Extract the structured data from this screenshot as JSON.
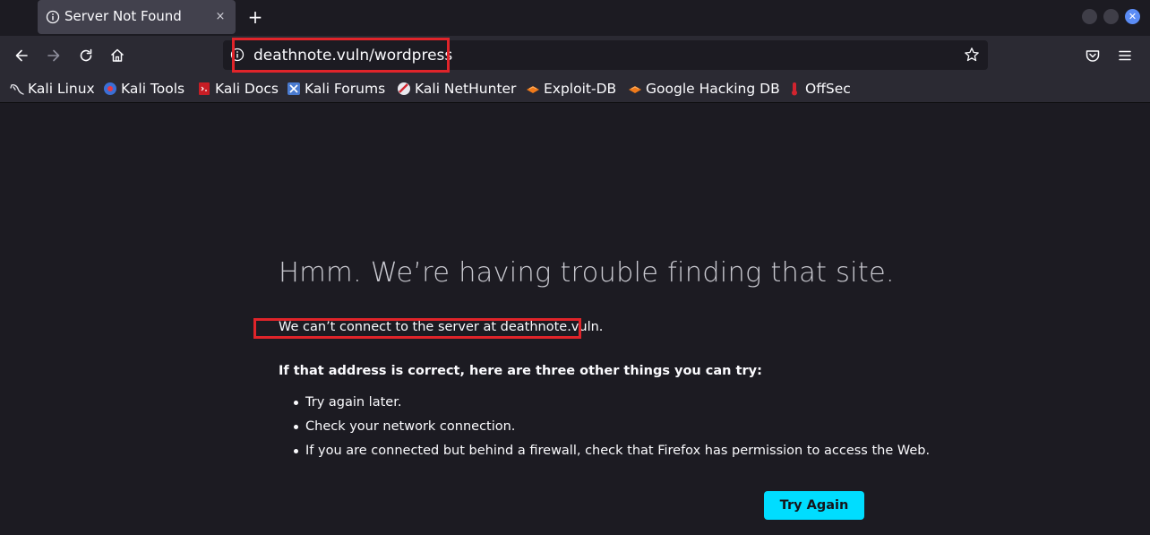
{
  "tab": {
    "title": "Server Not Found",
    "close_glyph": "×",
    "new_tab_glyph": "+"
  },
  "window_controls": [
    "minimize",
    "maximize",
    "close"
  ],
  "nav": {
    "back": "back-arrow-icon",
    "forward": "forward-arrow-icon",
    "reload": "reload-icon",
    "home": "home-icon",
    "url": "deathnote.vuln/wordpress",
    "pocket": "pocket-icon",
    "menu": "hamburger-menu-icon"
  },
  "bookmarks": [
    {
      "label": "Kali Linux",
      "icon": "kali-dragon-icon"
    },
    {
      "label": "Kali Tools",
      "icon": "kali-tools-icon"
    },
    {
      "label": "Kali Docs",
      "icon": "kali-docs-icon"
    },
    {
      "label": "Kali Forums",
      "icon": "kali-forums-icon"
    },
    {
      "label": "Kali NetHunter",
      "icon": "kali-nethunter-icon"
    },
    {
      "label": "Exploit-DB",
      "icon": "exploit-db-icon"
    },
    {
      "label": "Google Hacking DB",
      "icon": "ghdb-icon"
    },
    {
      "label": "OffSec",
      "icon": "offsec-icon"
    }
  ],
  "error": {
    "title": "Hmm. We’re having trouble finding that site.",
    "description": "We can’t connect to the server at deathnote.vuln.",
    "subtitle": "If that address is correct, here are three other things you can try:",
    "suggestions": [
      "Try again later.",
      "Check your network connection.",
      "If you are connected but behind a firewall, check that Firefox has permission to access the Web."
    ],
    "button": "Try Again"
  },
  "colors": {
    "page_bg": "#1c1b22",
    "toolbar_bg": "#2b2a33",
    "button_accent": "#00ddff",
    "highlight_box": "#e0242a"
  }
}
